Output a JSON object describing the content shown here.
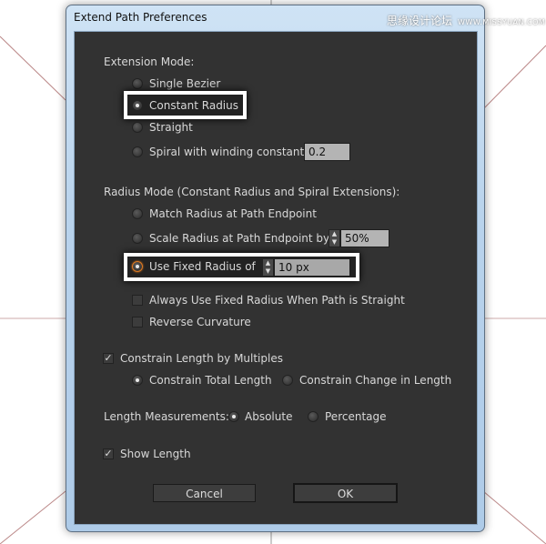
{
  "window": {
    "title": "Extend Path Preferences",
    "watermark": "思缘设计论坛 WWW.MISSYUAN.COM"
  },
  "extension_mode": {
    "label": "Extension Mode:",
    "options": [
      {
        "label": "Single Bezier",
        "selected": false
      },
      {
        "label": "Constant Radius",
        "selected": true
      },
      {
        "label": "Straight",
        "selected": false
      },
      {
        "label": "Spiral with winding constant",
        "selected": false
      }
    ],
    "winding_constant": "0.2"
  },
  "radius_mode": {
    "label": "Radius Mode (Constant Radius and Spiral Extensions):",
    "options": [
      {
        "label": "Match Radius at Path Endpoint",
        "selected": false
      },
      {
        "label": "Scale Radius at Path Endpoint by",
        "selected": false
      },
      {
        "label": "Use Fixed Radius of",
        "selected": true
      }
    ],
    "scale_value": "50%",
    "fixed_value": "10 px",
    "always_fixed": {
      "label": "Always Use Fixed Radius When Path is Straight",
      "checked": false
    },
    "reverse_curvature": {
      "label": "Reverse Curvature",
      "checked": false
    }
  },
  "constrain": {
    "label": "Constrain Length by Multiples",
    "checked": true,
    "options": [
      {
        "label": "Constrain Total Length",
        "selected": true
      },
      {
        "label": "Constrain Change in Length",
        "selected": false
      }
    ]
  },
  "length_measurements": {
    "label": "Length Measurements:",
    "options": [
      {
        "label": "Absolute",
        "selected": true
      },
      {
        "label": "Percentage",
        "selected": false
      }
    ]
  },
  "show_length": {
    "label": "Show Length",
    "checked": true
  },
  "buttons": {
    "cancel": "Cancel",
    "ok": "OK"
  },
  "colors": {
    "panel": "#323232",
    "focus": "#e07a20",
    "highlight": "#ffffff"
  }
}
